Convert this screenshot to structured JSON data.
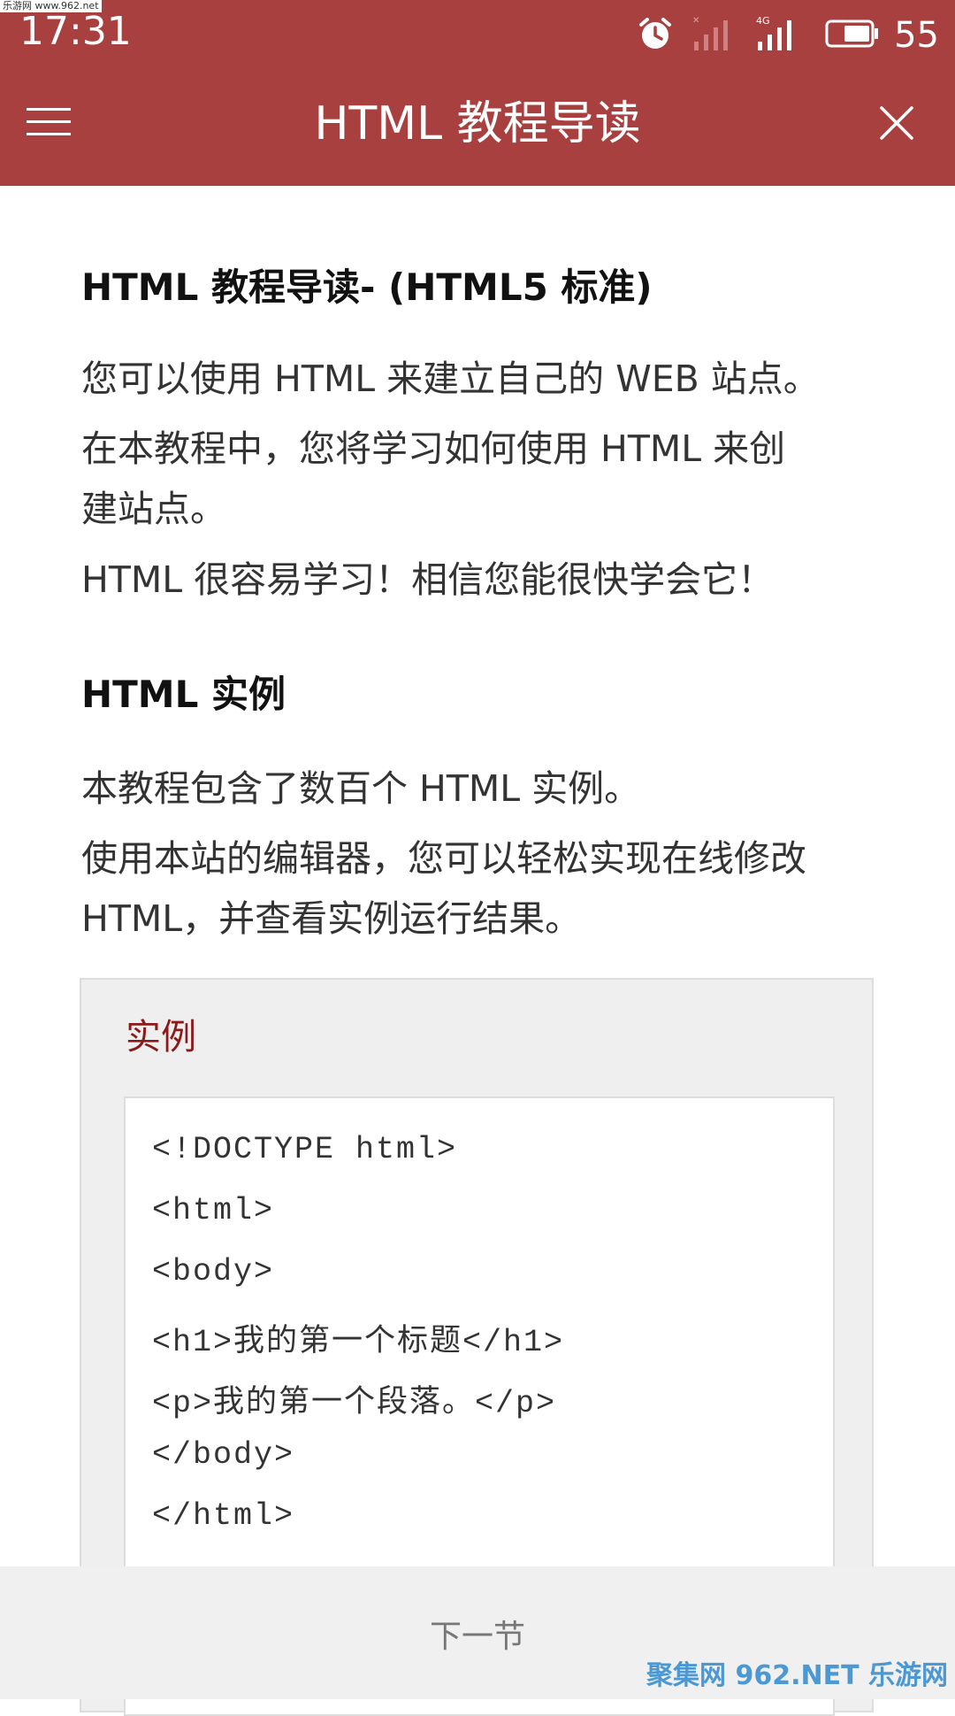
{
  "status_bar": {
    "time": "17:31",
    "battery_level": "55",
    "network": "4G",
    "icons": [
      "alarm-icon",
      "signal-empty-icon",
      "signal-4g-icon",
      "battery-icon"
    ]
  },
  "watermark": {
    "top": "乐游网 www.962.net",
    "bottom": "聚集网 962.NET 乐游网"
  },
  "app_bar": {
    "title": "HTML 教程导读",
    "menu_icon": "hamburger-menu-icon",
    "close_icon": "close-icon"
  },
  "content": {
    "heading1": "HTML 教程导读- (HTML5 标准)",
    "p1": "您可以使用 HTML 来建立自己的 WEB 站点。",
    "p2_line1": "在本教程中，您将学习如何使用 HTML 来创",
    "p2_line2": "建站点。",
    "p3": "HTML 很容易学习！相信您能很快学会它！",
    "heading2": "HTML 实例",
    "p4": "本教程包含了数百个 HTML 实例。",
    "p5_line1": "使用本站的编辑器，您可以轻松实现在线修改",
    "p5_line2": "HTML，并查看实例运行结果。"
  },
  "example": {
    "label": "实例",
    "code_lines": [
      "<!DOCTYPE html>",
      "<html>",
      "<body>",
      "<h1>我的第一个标题</h1>",
      "<p>我的第一个段落。</p>",
      "</body>",
      "</html>"
    ]
  },
  "bottom_bar": {
    "next_label": "下一节"
  },
  "colors": {
    "app_bar": "#a94040",
    "example_label": "#8b1a1a",
    "example_bg": "#efefef",
    "bottom_bar_bg": "#f0f0f0"
  }
}
